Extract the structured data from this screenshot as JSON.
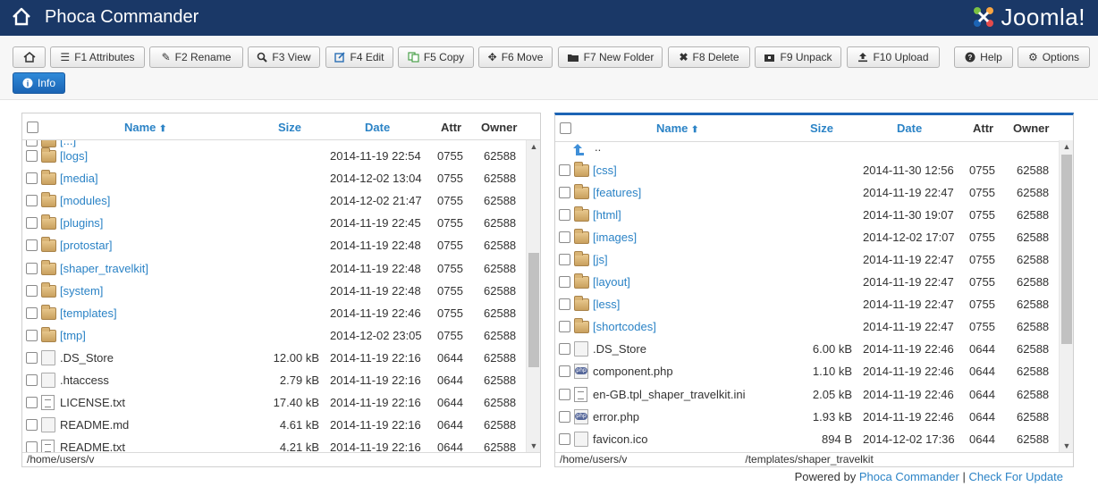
{
  "app": {
    "title": "Phoca Commander",
    "brand": "Joomla!"
  },
  "toolbar": {
    "buttons": [
      {
        "id": "home",
        "label": "",
        "icon": "home-icon"
      },
      {
        "id": "f1",
        "label": "F1 Attributes",
        "icon": "list-icon"
      },
      {
        "id": "f2",
        "label": "F2 Rename",
        "icon": "pencil-icon"
      },
      {
        "id": "f3",
        "label": "F3 View",
        "icon": "search-icon"
      },
      {
        "id": "f4",
        "label": "F4 Edit",
        "icon": "edit-icon"
      },
      {
        "id": "f5",
        "label": "F5 Copy",
        "icon": "copy-icon"
      },
      {
        "id": "f6",
        "label": "F6 Move",
        "icon": "move-icon"
      },
      {
        "id": "f7",
        "label": "F7 New Folder",
        "icon": "folder-icon"
      },
      {
        "id": "f8",
        "label": "F8 Delete",
        "icon": "delete-icon"
      },
      {
        "id": "f9",
        "label": "F9 Unpack",
        "icon": "archive-icon"
      },
      {
        "id": "f10",
        "label": "F10 Upload",
        "icon": "upload-icon"
      },
      {
        "id": "help",
        "label": "Help",
        "icon": "question-icon"
      },
      {
        "id": "options",
        "label": "Options",
        "icon": "gear-icon"
      },
      {
        "id": "info",
        "label": "Info",
        "icon": "info-icon"
      }
    ]
  },
  "columns": {
    "name": "Name",
    "size": "Size",
    "date": "Date",
    "attr": "Attr",
    "owner": "Owner"
  },
  "left_panel": {
    "partial_top": "[...]",
    "rows": [
      {
        "type": "folder",
        "name": "[logs]",
        "size": "",
        "date": "2014-11-19 22:54",
        "attr": "0755",
        "owner": "62588"
      },
      {
        "type": "folder",
        "name": "[media]",
        "size": "",
        "date": "2014-12-02 13:04",
        "attr": "0755",
        "owner": "62588"
      },
      {
        "type": "folder",
        "name": "[modules]",
        "size": "",
        "date": "2014-12-02 21:47",
        "attr": "0755",
        "owner": "62588"
      },
      {
        "type": "folder",
        "name": "[plugins]",
        "size": "",
        "date": "2014-11-19 22:45",
        "attr": "0755",
        "owner": "62588"
      },
      {
        "type": "folder",
        "name": "[protostar]",
        "size": "",
        "date": "2014-11-19 22:48",
        "attr": "0755",
        "owner": "62588"
      },
      {
        "type": "folder",
        "name": "[shaper_travelkit]",
        "size": "",
        "date": "2014-11-19 22:48",
        "attr": "0755",
        "owner": "62588"
      },
      {
        "type": "folder",
        "name": "[system]",
        "size": "",
        "date": "2014-11-19 22:48",
        "attr": "0755",
        "owner": "62588"
      },
      {
        "type": "folder",
        "name": "[templates]",
        "size": "",
        "date": "2014-11-19 22:46",
        "attr": "0755",
        "owner": "62588"
      },
      {
        "type": "folder",
        "name": "[tmp]",
        "size": "",
        "date": "2014-12-02 23:05",
        "attr": "0755",
        "owner": "62588"
      },
      {
        "type": "file",
        "name": ".DS_Store",
        "size": "12.00 kB",
        "date": "2014-11-19 22:16",
        "attr": "0644",
        "owner": "62588"
      },
      {
        "type": "file",
        "name": ".htaccess",
        "size": "2.79 kB",
        "date": "2014-11-19 22:16",
        "attr": "0644",
        "owner": "62588"
      },
      {
        "type": "text",
        "name": "LICENSE.txt",
        "size": "17.40 kB",
        "date": "2014-11-19 22:16",
        "attr": "0644",
        "owner": "62588"
      },
      {
        "type": "file",
        "name": "README.md",
        "size": "4.61 kB",
        "date": "2014-11-19 22:16",
        "attr": "0644",
        "owner": "62588"
      },
      {
        "type": "text",
        "name": "README.txt",
        "size": "4.21 kB",
        "date": "2014-11-19 22:16",
        "attr": "0644",
        "owner": "62588"
      }
    ],
    "path": "/home/users/v"
  },
  "right_panel": {
    "up": "..",
    "rows": [
      {
        "type": "folder",
        "name": "[css]",
        "size": "",
        "date": "2014-11-30 12:56",
        "attr": "0755",
        "owner": "62588"
      },
      {
        "type": "folder",
        "name": "[features]",
        "size": "",
        "date": "2014-11-19 22:47",
        "attr": "0755",
        "owner": "62588"
      },
      {
        "type": "folder",
        "name": "[html]",
        "size": "",
        "date": "2014-11-30 19:07",
        "attr": "0755",
        "owner": "62588"
      },
      {
        "type": "folder",
        "name": "[images]",
        "size": "",
        "date": "2014-12-02 17:07",
        "attr": "0755",
        "owner": "62588"
      },
      {
        "type": "folder",
        "name": "[js]",
        "size": "",
        "date": "2014-11-19 22:47",
        "attr": "0755",
        "owner": "62588"
      },
      {
        "type": "folder",
        "name": "[layout]",
        "size": "",
        "date": "2014-11-19 22:47",
        "attr": "0755",
        "owner": "62588"
      },
      {
        "type": "folder",
        "name": "[less]",
        "size": "",
        "date": "2014-11-19 22:47",
        "attr": "0755",
        "owner": "62588"
      },
      {
        "type": "folder",
        "name": "[shortcodes]",
        "size": "",
        "date": "2014-11-19 22:47",
        "attr": "0755",
        "owner": "62588"
      },
      {
        "type": "file",
        "name": ".DS_Store",
        "size": "6.00 kB",
        "date": "2014-11-19 22:46",
        "attr": "0644",
        "owner": "62588"
      },
      {
        "type": "php",
        "name": "component.php",
        "size": "1.10 kB",
        "date": "2014-11-19 22:46",
        "attr": "0644",
        "owner": "62588"
      },
      {
        "type": "text",
        "name": "en-GB.tpl_shaper_travelkit.ini",
        "size": "2.05 kB",
        "date": "2014-11-19 22:46",
        "attr": "0644",
        "owner": "62588"
      },
      {
        "type": "php",
        "name": "error.php",
        "size": "1.93 kB",
        "date": "2014-11-19 22:46",
        "attr": "0644",
        "owner": "62588"
      },
      {
        "type": "file",
        "name": "favicon.ico",
        "size": "894 B",
        "date": "2014-12-02 17:36",
        "attr": "0644",
        "owner": "62588"
      }
    ],
    "path_start": "/home/users/v",
    "path_end": "/templates/shaper_travelkit"
  },
  "footer": {
    "prefix": "Powered by",
    "link1": "Phoca Commander",
    "separator": "|",
    "link2": "Check For Update"
  },
  "colors": {
    "header_bg": "#1a3867",
    "link": "#2b83c6",
    "info_button": "#1f6fc5"
  }
}
